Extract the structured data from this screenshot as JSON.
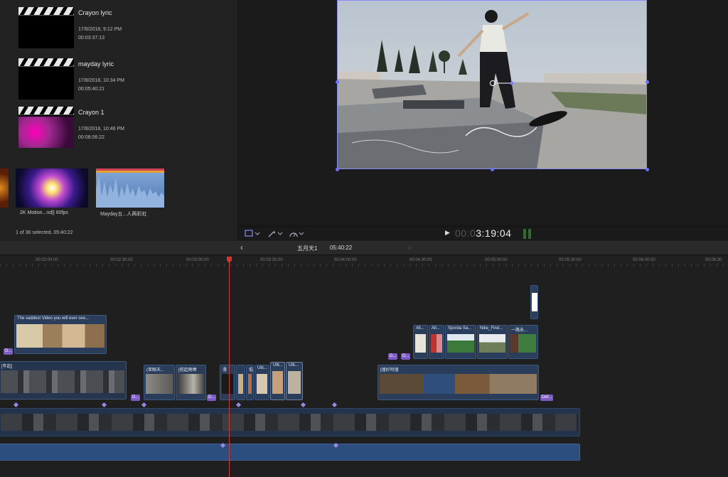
{
  "browser": {
    "events": [
      {
        "name": "Crayon lyric",
        "date": "17/8/2018, 9:12 PM",
        "duration": "00:03:37:13"
      },
      {
        "name": "mayday lyric",
        "date": "17/8/2018, 10:34 PM",
        "duration": "00:05:40:21"
      },
      {
        "name": "Crayon 1",
        "date": "17/8/2018, 10:46 PM",
        "duration": "00:08:06:22"
      }
    ],
    "clips": [
      {
        "label": "2K Motion...nd|| 60fps"
      },
      {
        "label": "Mayday五...人两彩虹"
      }
    ],
    "status": "1 of 36 selected, 05:40:22"
  },
  "viewer": {
    "timecode_dim": "00:0",
    "timecode": "3:19:04",
    "icons": {
      "transform": "transform-icon",
      "enhance": "magic-wand-icon",
      "speed": "speed-gauge-icon",
      "play": "play-icon"
    }
  },
  "timeline": {
    "project_name": "五月天1",
    "project_duration": "05:40:22",
    "ruler": [
      "00:02:00:00",
      "00:02:30:00",
      "00:03:00:00",
      "00:03:30:00",
      "00:04:00:00",
      "00:04:30:00",
      "00:05:00:00",
      "00:05:30:00",
      "00:06:00:00",
      "00:06:30"
    ],
    "clips": {
      "saddest": "The saddest Video you will ever see...",
      "c2": "(单眼天...",
      "c3": "[搭起雨棒",
      "c4": "滑",
      "c5": "低",
      "c6": "Ulti...",
      "c7": "Ulti...",
      "c8": "Ulti...",
      "c9": "[撞好阿撞",
      "top1": "All...",
      "top2": "All...",
      "top3": "Sporda Sa...",
      "top4": "Nike_Find...",
      "top5": "一路永...",
      "left": "[年起]"
    },
    "markers": {
      "m1": "D...",
      "m2": "D...",
      "m3": "D...",
      "m4": "D...",
      "m5": "D...",
      "m6": "Def..."
    }
  },
  "colors": {
    "accent": "#6f6fff",
    "playhead": "#d9342b",
    "clip": "#2a3d5a",
    "marker": "#7c5cc4"
  }
}
